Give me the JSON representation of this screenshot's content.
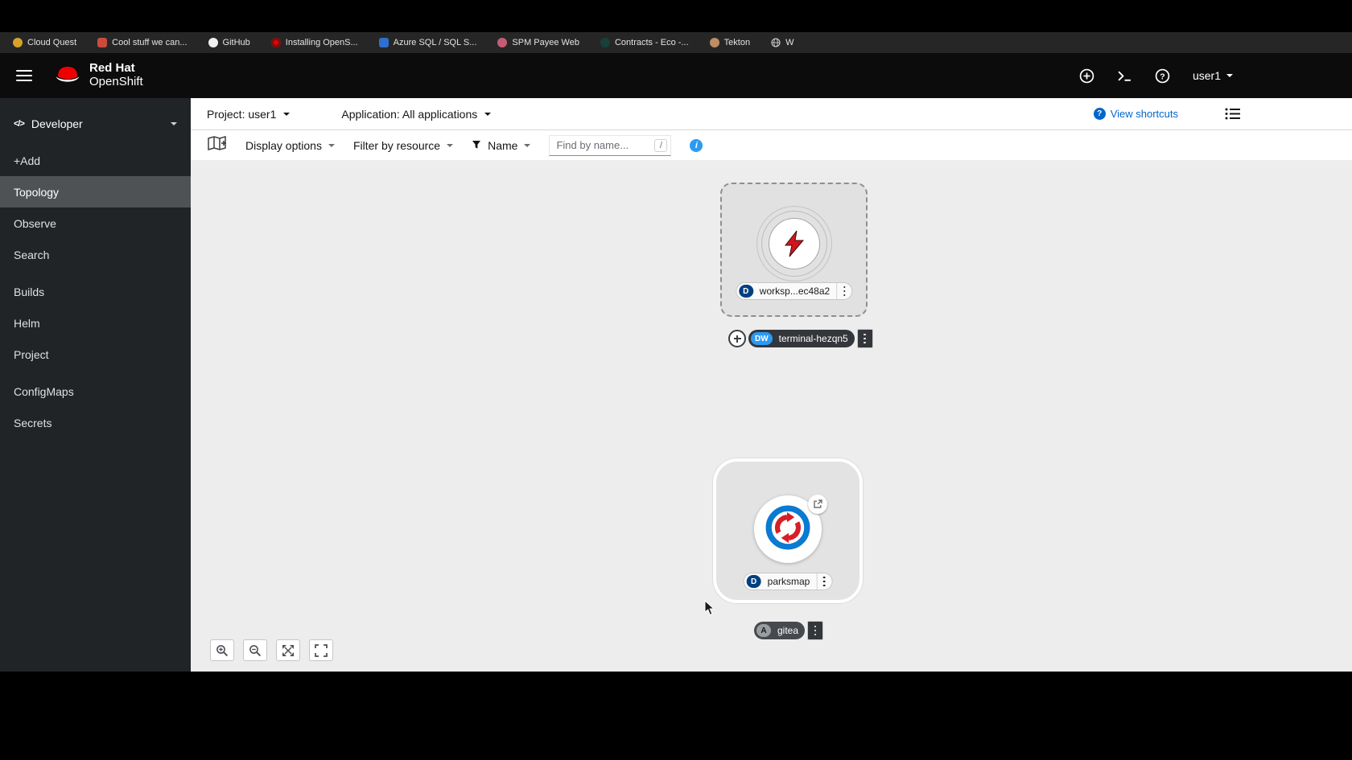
{
  "colors": {
    "brand_red": "#ee0000",
    "link_blue": "#0066cc",
    "info_blue": "#2b9af3",
    "badge_deployment": "#004080",
    "badge_devworkspace": "#2b9af3",
    "badge_application": "#9a9da0",
    "sidebar_bg": "#212427",
    "canvas_bg": "#ededed"
  },
  "bookmarks": {
    "items": [
      "Cloud Quest",
      "Cool stuff we can...",
      "GitHub",
      "Installing OpenS...",
      "Azure SQL / SQL S...",
      "SPM Payee Web",
      "Contracts - Eco -...",
      "Tekton",
      "W"
    ]
  },
  "masthead": {
    "brand_line1": "Red Hat",
    "brand_line2": "OpenShift",
    "username": "user1"
  },
  "sidebar": {
    "perspective": "Developer",
    "items": [
      "+Add",
      "Topology",
      "Observe",
      "Search",
      "Builds",
      "Helm",
      "Project",
      "ConfigMaps",
      "Secrets"
    ]
  },
  "context_bar": {
    "project": "Project: user1",
    "application": "Application: All applications",
    "view_shortcuts": "View shortcuts"
  },
  "toolbar": {
    "display_options": "Display options",
    "filter_by_resource": "Filter by resource",
    "name_filter": "Name",
    "find_placeholder": "Find by name...",
    "shortcut_key": "/"
  },
  "topology": {
    "workspace": {
      "badge": "D",
      "label": "worksp...ec48a2"
    },
    "terminal": {
      "badge": "DW",
      "label": "terminal-hezqn5"
    },
    "parksmap": {
      "badge": "D",
      "label": "parksmap"
    },
    "gitea": {
      "badge": "A",
      "label": "gitea"
    }
  }
}
